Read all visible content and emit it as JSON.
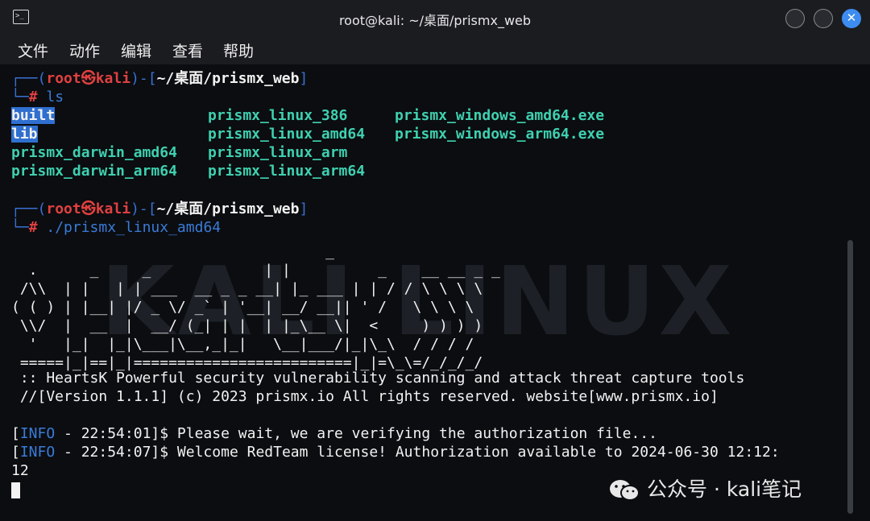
{
  "window": {
    "title": "root@kali: ~/桌面/prismx_web",
    "close_glyph": "✕"
  },
  "menu": [
    {
      "label": "文件"
    },
    {
      "label": "动作"
    },
    {
      "label": "编辑"
    },
    {
      "label": "查看"
    },
    {
      "label": "帮助"
    }
  ],
  "prompt1": {
    "corner_top": "┌──(",
    "user": "root㉿kali",
    "mid": ")-[",
    "path": "~/桌面/prismx_web",
    "end": "]",
    "corner_bottom": "└─",
    "hash": "#",
    "command": "ls"
  },
  "ls_output": {
    "col1": [
      "built",
      "lib",
      "prismx_darwin_amd64",
      "prismx_darwin_arm64"
    ],
    "col2": [
      "prismx_linux_386",
      "prismx_linux_amd64",
      "prismx_linux_arm",
      "prismx_linux_arm64"
    ],
    "col3": [
      "prismx_windows_amd64.exe",
      "prismx_windows_arm64.exe"
    ]
  },
  "prompt2": {
    "corner_top": "┌──(",
    "user": "root㉿kali",
    "mid": ")-[",
    "path": "~/桌面/prismx_web",
    "end": "]",
    "corner_bottom": "└─",
    "hash": "#",
    "command": "./prismx_linux_amd64"
  },
  "banner": {
    "ascii": "                                    _\n  .      _     _             | |          _    __ __ _ _\n /\\\\  | |   | | ___  __ _ _ __| |_ ___ | | / / \\ \\ \\ \\\n( ( ) | |__| |/ _ \\/ _` | '__| __/ __|| ' /   \\ \\ \\ \\\n \\\\/  |  __  |  __/ (_| | |  | |_\\__ \\|  <     ) ) ) )\n  '   |_|  |_|\\___|\\__,_|_|   \\__|___/|_|\\_\\  / / / /\n =====|_|==|_|=========================|_|=\\_\\=/_/_/_/",
    "tagline": " :: HeartsK Powerful security vulnerability scanning and attack threat capture tools",
    "version": " //[Version 1.1.1] (c) 2023 prismx.io All rights reserved. website[www.prismx.io]"
  },
  "logs": [
    {
      "open": "[",
      "level": "INFO",
      "rest": " - 22:54:01]$ Please wait, we are verifying the authorization file..."
    },
    {
      "open": "[",
      "level": "INFO",
      "rest": " - 22:54:07]$ Welcome RedTeam license! Authorization available to 2024-06-30 12:12:"
    }
  ],
  "log_wrap": "12",
  "overlay": {
    "watermark": "KALI LINUX",
    "wechat_text": "公众号 · kali笔记"
  }
}
